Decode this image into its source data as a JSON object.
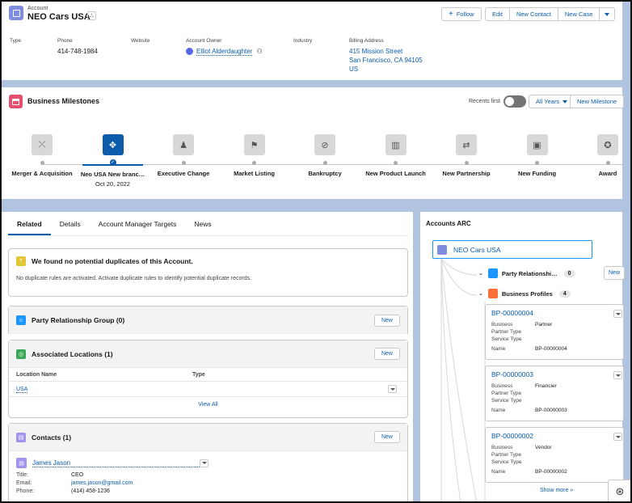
{
  "header": {
    "object_type": "Account",
    "name": "NEO Cars USA",
    "hierarchy_icon": "hierarchy-icon",
    "buttons": {
      "follow": "Follow",
      "edit": "Edit",
      "new_contact": "New Contact",
      "new_case": "New Case"
    },
    "fields": {
      "type": {
        "label": "Type",
        "value": ""
      },
      "phone": {
        "label": "Phone",
        "value": "414-748-1984"
      },
      "website": {
        "label": "Website",
        "value": ""
      },
      "owner": {
        "label": "Account Owner",
        "value": "Elliot Alderdaughter"
      },
      "industry": {
        "label": "Industry",
        "value": ""
      },
      "billing": {
        "label": "Billing Address",
        "line1": "415 Mission Street",
        "line2": "San Francisco, CA 94105",
        "line3": "US"
      }
    }
  },
  "milestones": {
    "title": "Business Milestones",
    "recents_label": "Recents first",
    "recents_on": false,
    "years_label": "All Years",
    "new_button": "New Milestone",
    "items": [
      {
        "label": "Merger & Acquisition",
        "icon": "merge-icon",
        "glyph": "⤫",
        "date": ""
      },
      {
        "label": "Neo USA New branc…",
        "icon": "branch-icon",
        "glyph": "✥",
        "date": "Oct 20, 2022",
        "active": true
      },
      {
        "label": "Executive Change",
        "icon": "executive-change-icon",
        "glyph": "♟",
        "date": ""
      },
      {
        "label": "Market Listing",
        "icon": "flag-icon",
        "glyph": "⚑",
        "date": ""
      },
      {
        "label": "Bankruptcy",
        "icon": "ban-icon",
        "glyph": "⊘",
        "date": ""
      },
      {
        "label": "New Product Launch",
        "icon": "barcode-icon",
        "glyph": "▥",
        "date": ""
      },
      {
        "label": "New Partnership",
        "icon": "handshake-icon",
        "glyph": "⇄",
        "date": ""
      },
      {
        "label": "New Funding",
        "icon": "money-icon",
        "glyph": "▣",
        "date": ""
      },
      {
        "label": "Award",
        "icon": "award-icon",
        "glyph": "✪",
        "date": ""
      }
    ]
  },
  "tabs": [
    "Related",
    "Details",
    "Account Manager Targets",
    "News"
  ],
  "duplicates": {
    "title": "We found no potential duplicates of this Account.",
    "message": "No duplicate rules are activated. Activate duplicate rules to identify potential duplicate records."
  },
  "party_group": {
    "title": "Party Relationship Group (0)",
    "new": "New"
  },
  "locations": {
    "title": "Associated Locations (1)",
    "new": "New",
    "columns": [
      "Location Name",
      "Type"
    ],
    "rows": [
      {
        "name": "USA",
        "type": ""
      }
    ],
    "view_all": "View All"
  },
  "contacts": {
    "title": "Contacts (1)",
    "new": "New",
    "name": "James Jason",
    "title_label": "Title:",
    "title_value": "CEO",
    "email_label": "Email:",
    "email_value": "james.jason@gmail.com",
    "phone_label": "Phone:",
    "phone_value": "(414) 458-1236"
  },
  "arc": {
    "title": "Accounts ARC",
    "root": "NEO Cars USA",
    "party_node": {
      "label": "Party Relationshi…",
      "count": "0"
    },
    "profiles_node": {
      "label": "Business Profiles",
      "count": "4"
    },
    "edge_button": "New",
    "profiles": [
      {
        "id": "BP-00000004",
        "business": "Partner",
        "name": "BP-00000004"
      },
      {
        "id": "BP-00000003",
        "business": "Financier",
        "name": "BP-00000003"
      },
      {
        "id": "BP-00000002",
        "business": "Vendor",
        "name": "BP-00000002"
      }
    ],
    "labels": {
      "business": "Business",
      "partner_type": "Partner Type",
      "service_type": "Service Type",
      "name": "Name"
    },
    "show_more": "Show more »"
  },
  "colors": {
    "accent": "#0b5cab",
    "account_icon": "#7f8de1",
    "milestone_icon": "#e3506f",
    "page_bg": "#b0c4df"
  }
}
